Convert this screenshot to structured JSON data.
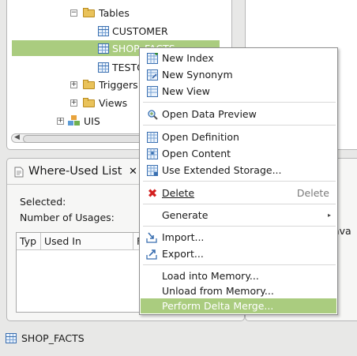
{
  "tree": {
    "tables_label": "Tables",
    "customer_label": "CUSTOMER",
    "shop_facts_label": "SHOP_FACTS",
    "testo_label": "TESTO",
    "triggers_label": "Triggers",
    "views_label": "Views",
    "uis_label": "UIS"
  },
  "where_used": {
    "title": "Where-Used List",
    "selected_label": "Selected:",
    "usages_label": "Number of Usages:",
    "col_type": "Typ",
    "col_used_in": "Used In",
    "col_third": "F"
  },
  "right_panel": {
    "partial_text": "t ava"
  },
  "status_bar": {
    "selection_label": "SHOP_FACTS"
  },
  "context_menu": {
    "items": [
      {
        "label": "New Index"
      },
      {
        "label": "New Synonym"
      },
      {
        "label": "New View"
      },
      {
        "label": "Open Data Preview"
      },
      {
        "label": "Open Definition"
      },
      {
        "label": "Open Content"
      },
      {
        "label": "Use Extended Storage..."
      },
      {
        "label": "Delete",
        "shortcut": "Delete"
      },
      {
        "label": "Generate",
        "submenu": "▸"
      },
      {
        "label": "Import..."
      },
      {
        "label": "Export..."
      },
      {
        "label": "Load into Memory..."
      },
      {
        "label": "Unload from Memory..."
      },
      {
        "label": "Perform Delta Merge..."
      }
    ]
  },
  "colors": {
    "selection": "#aacc7f",
    "table_icon": "#3a6fb0",
    "folder_icon": "#e9c25a",
    "delete_icon": "#d32020"
  },
  "icons": {
    "tables_folder": "folder-icon",
    "table": "table-icon",
    "schema": "schema-icon",
    "delete": "delete-x-icon"
  }
}
